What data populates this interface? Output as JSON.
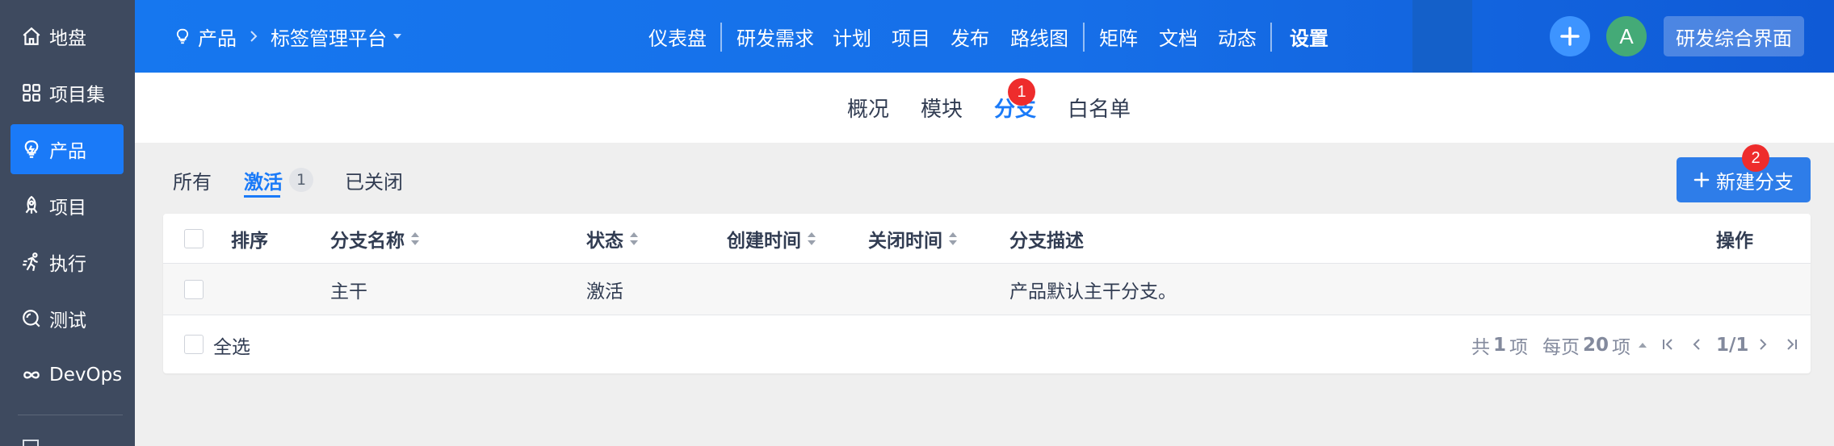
{
  "sidebar": {
    "items": [
      {
        "label": "地盘",
        "icon": "home-icon"
      },
      {
        "label": "项目集",
        "icon": "grid-icon"
      },
      {
        "label": "产品",
        "icon": "lightbulb-icon"
      },
      {
        "label": "项目",
        "icon": "rocket-icon"
      },
      {
        "label": "执行",
        "icon": "run-icon"
      },
      {
        "label": "测试",
        "icon": "test-icon"
      },
      {
        "label": "DevOps",
        "icon": "infinity-icon"
      }
    ],
    "active_index": 2
  },
  "header": {
    "breadcrumb_root": "产品",
    "breadcrumb_current": "标签管理平台",
    "nav": [
      "仪表盘",
      "研发需求",
      "计划",
      "项目",
      "发布",
      "路线图",
      "矩阵",
      "文档",
      "动态",
      "设置"
    ],
    "nav_active": "设置",
    "avatar_letter": "A",
    "view_button": "研发综合界面"
  },
  "subnav": {
    "items": [
      "概况",
      "模块",
      "分支",
      "白名单"
    ],
    "active": "分支",
    "badge": "1"
  },
  "filters": {
    "all": "所有",
    "active": "激活",
    "active_count": "1",
    "closed": "已关闭"
  },
  "new_button": {
    "label": "新建分支",
    "badge": "2"
  },
  "table": {
    "columns": [
      "排序",
      "分支名称",
      "状态",
      "创建时间",
      "关闭时间",
      "分支描述",
      "操作"
    ],
    "rows": [
      {
        "order": "",
        "name": "主干",
        "status": "激活",
        "created": "",
        "closed": "",
        "desc": "产品默认主干分支。",
        "actions": ""
      }
    ],
    "select_all": "全选",
    "total_prefix": "共",
    "total_count": "1",
    "total_suffix": "项",
    "per_page_prefix": "每页",
    "per_page": "20",
    "per_page_suffix": "项",
    "page_indicator": "1/1"
  },
  "colors": {
    "primary": "#1a7af8",
    "sidebar_bg": "#3e4a5f",
    "badge_red": "#ee2c2c"
  }
}
